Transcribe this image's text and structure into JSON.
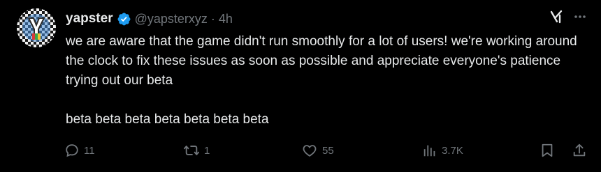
{
  "author": {
    "display_name": "yapster",
    "handle": "@yapsterxyz",
    "separator": "·",
    "time": "4h",
    "verified": true,
    "avatar_icon": "checkered-y-logo"
  },
  "tweet": {
    "text": "we are aware that the game didn't run smoothly for a lot of users! we're working around the clock to fix these issues as soon as possible and appreciate everyone's patience trying out our beta\n\nbeta beta beta beta beta beta beta"
  },
  "actions": {
    "replies": "11",
    "reposts": "1",
    "likes": "55",
    "views": "3.7K"
  },
  "icons": {
    "reply": "speech-bubble-icon",
    "repost": "repost-arrows-icon",
    "like": "heart-icon",
    "views": "bar-chart-icon",
    "bookmark": "bookmark-icon",
    "share": "share-icon",
    "grok": "grok-icon",
    "more": "more-dots-icon"
  },
  "colors": {
    "background": "#000000",
    "text": "#e7e9ea",
    "secondary": "#71767b",
    "verified": "#1d9bf0"
  }
}
